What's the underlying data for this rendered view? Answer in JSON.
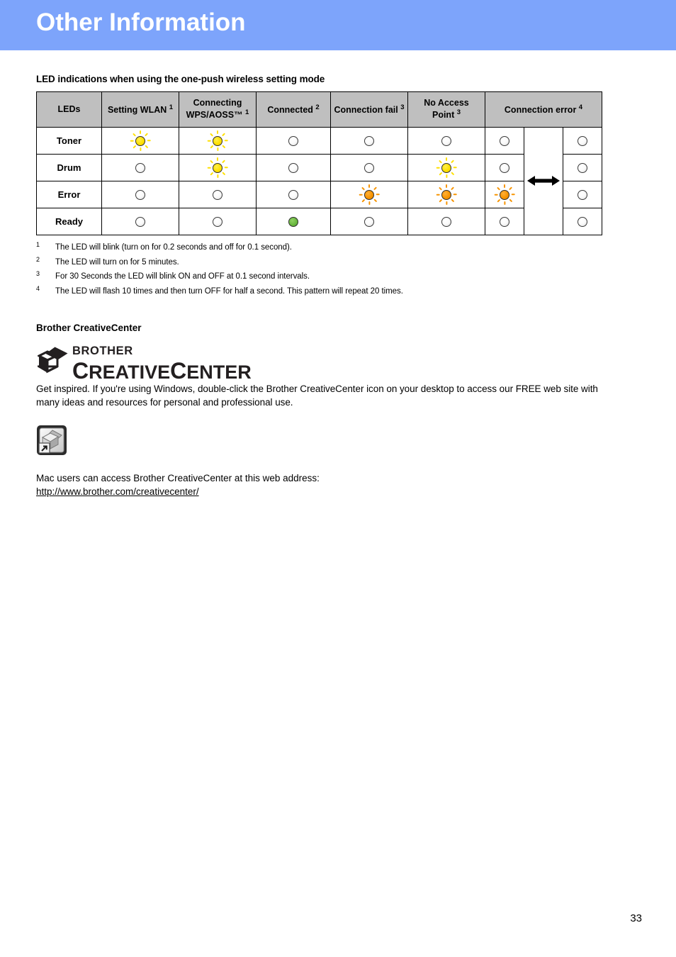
{
  "header": {
    "title": "Other Information",
    "bar_color": "#7da4fb"
  },
  "section": {
    "heading": "LED indications when using the one-push wireless setting mode"
  },
  "table": {
    "columns": [
      {
        "label": "LEDs",
        "sup": ""
      },
      {
        "label": "Setting WLAN",
        "sup": "1"
      },
      {
        "label": "Connecting WPS/AOSS™",
        "sup": "1"
      },
      {
        "label": "Connected",
        "sup": "2"
      },
      {
        "label": "Connection fail",
        "sup": "3"
      },
      {
        "label": "No Access Point",
        "sup": "3"
      },
      {
        "label": "Connection error",
        "sup": "4"
      }
    ],
    "rows": [
      {
        "label": "Toner",
        "states": [
          "yellow-blink",
          "yellow-blink",
          "off",
          "off",
          "off",
          "off",
          "arrow",
          "off"
        ]
      },
      {
        "label": "Drum",
        "states": [
          "off",
          "yellow-blink",
          "off",
          "off",
          "yellow-blink",
          "off",
          "arrow",
          "off"
        ]
      },
      {
        "label": "Error",
        "states": [
          "off",
          "off",
          "off",
          "orange-blink",
          "orange-blink",
          "orange-blink",
          "arrow",
          "off"
        ]
      },
      {
        "label": "Ready",
        "states": [
          "off",
          "off",
          "green-on",
          "off",
          "off",
          "off",
          "arrow",
          "off"
        ]
      }
    ],
    "header_bg": "#bfbfbf",
    "led_colors": {
      "off": "#f2f2f2",
      "green": "#6ab83f",
      "yellow": "#ffe000",
      "orange": "#f79400"
    }
  },
  "footnotes": [
    {
      "num": "1",
      "text": "The LED will blink (turn on for 0.2 seconds and off for 0.1 second)."
    },
    {
      "num": "2",
      "text": "The LED will turn on for 5 minutes."
    },
    {
      "num": "3",
      "text": "For 30 Seconds the LED will blink ON and OFF at 0.1 second intervals."
    },
    {
      "num": "4",
      "text": "The LED will flash 10 times and then turn OFF for half a second. This pattern will repeat 20 times."
    }
  ],
  "creativecenter": {
    "heading": "Brother CreativeCenter",
    "logo_brother": "BROTHER",
    "logo_c1": "C",
    "logo_reative": "REATIVE",
    "logo_c2": "C",
    "logo_enter": "ENTER",
    "paragraph": "Get inspired. If you're using Windows, double-click the Brother CreativeCenter icon on your desktop to access our FREE web site with many ideas and resources for personal and professional use.",
    "mac_text": "Mac users can access Brother CreativeCenter at this web address:",
    "url": "http://www.brother.com/creativecenter/"
  },
  "footer": {
    "page_number": "33"
  }
}
